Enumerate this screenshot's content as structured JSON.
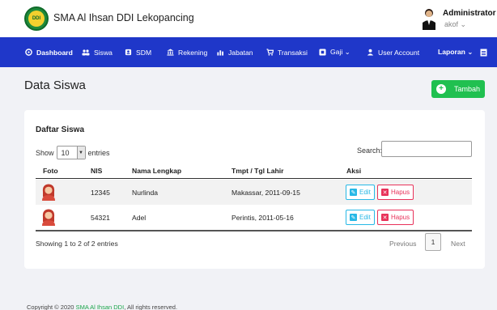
{
  "header": {
    "brand": "SMA Al Ihsan DDI Lekopancing",
    "logo_text": "DDI",
    "user_name": "Administrator",
    "user_sub": "akof ⌄"
  },
  "nav": {
    "items": [
      {
        "label": "Dashboard",
        "icon": "dashboard-icon"
      },
      {
        "label": "Siswa",
        "icon": "users-icon"
      },
      {
        "label": "SDM",
        "icon": "id-card-icon"
      },
      {
        "label": "Rekening",
        "icon": "bank-icon"
      },
      {
        "label": "Jabatan",
        "icon": "chart-icon"
      },
      {
        "label": "Transaksi",
        "icon": "cart-icon"
      },
      {
        "label": "Gaji ⌄",
        "icon": "money-icon"
      },
      {
        "label": "User Account",
        "icon": "user-icon"
      },
      {
        "label": "Laporan ⌄",
        "icon": "document-icon"
      }
    ]
  },
  "page": {
    "title": "Data Siswa",
    "add_button": "Tambah"
  },
  "table": {
    "title": "Daftar Siswa",
    "show_label": "Show",
    "entries_value": "10",
    "entries_label": "entries",
    "search_label": "Search:",
    "search_value": "",
    "columns": [
      "Foto",
      "NIS",
      "Nama Lengkap",
      "Tmpt / Tgl Lahir",
      "Aksi"
    ],
    "rows": [
      {
        "nis": "12345",
        "nama": "Nurlinda",
        "ttl": "Makassar, 2011-09-15",
        "edit": "Edit",
        "hapus": "Hapus"
      },
      {
        "nis": "54321",
        "nama": "Adel",
        "ttl": "Perintis, 2011-05-16",
        "edit": "Edit",
        "hapus": "Hapus"
      }
    ],
    "info": "Showing 1 to 2 of 2 entries",
    "prev": "Previous",
    "page": "1",
    "next": "Next"
  },
  "footer": {
    "prefix": "Copyright © 2020",
    "link": "SMA Al Ihsan DDI",
    "suffix": ", All rights reserved."
  },
  "colors": {
    "nav": "#1f37c9",
    "accent_green": "#20c050",
    "edit": "#27b8e6",
    "delete": "#e8325a"
  }
}
